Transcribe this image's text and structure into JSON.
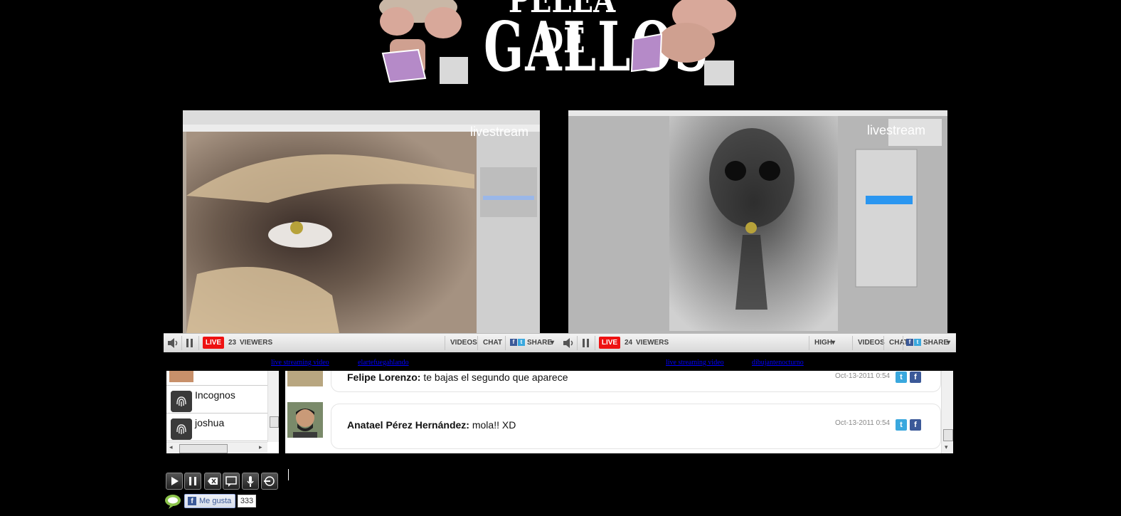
{
  "header": {
    "logo_text": "GALLOS",
    "logo_top": "PELEA DE"
  },
  "player_left": {
    "live_label": "LIVE",
    "viewers_count": "23",
    "viewers_label": "VIEWERS",
    "videos_label": "VIDEOS",
    "chat_label": "CHAT",
    "share_label": "SHARE",
    "watermark": "livestream",
    "link_main": "live streaming video",
    "link_channel": "elartefuegahlando"
  },
  "player_right": {
    "live_label": "LIVE",
    "viewers_count": "24",
    "viewers_label": "VIEWERS",
    "quality_label": "HIGH",
    "videos_label": "VIDEOS",
    "chat_label": "CHAT",
    "share_label": "SHARE",
    "watermark": "livestream",
    "link_main": "live streaming video",
    "link_channel": "dibujantenocturno"
  },
  "users": [
    {
      "name": "Incognos"
    },
    {
      "name": "joshua"
    }
  ],
  "messages": [
    {
      "author": "Felipe Lorenzo:",
      "text": "te bajas el segundo que aparece",
      "date": "Oct-13-2011 0:54"
    },
    {
      "author": "Anatael Pérez Hernández:",
      "text": "mola!! XD",
      "date": "Oct-13-2011 0:54"
    }
  ],
  "social": {
    "like_label": "Me gusta",
    "like_count": "333"
  },
  "colors": {
    "live_red": "#ee1111",
    "link_blue": "#0000ff",
    "facebook": "#3b5998",
    "twitter": "#3aa8de"
  }
}
